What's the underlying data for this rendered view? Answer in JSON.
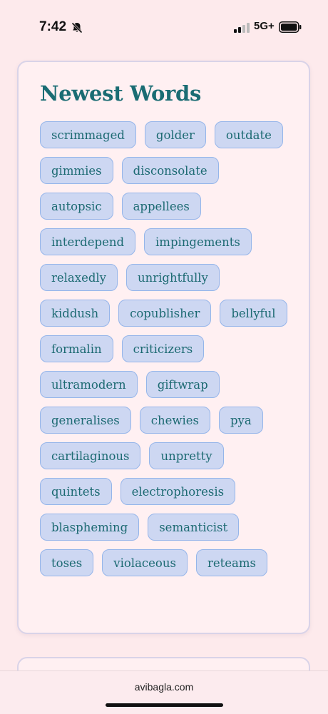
{
  "status_bar": {
    "time": "7:42",
    "network": "5G+",
    "icons": [
      "bell-muted-icon",
      "signal-icon",
      "battery-icon"
    ]
  },
  "newest_words": {
    "title": "Newest Words",
    "words": [
      "scrimmaged",
      "golder",
      "outdate",
      "gimmies",
      "disconsolate",
      "autopsic",
      "appellees",
      "interdepend",
      "impingements",
      "relaxedly",
      "unrightfully",
      "kiddush",
      "copublisher",
      "bellyful",
      "formalin",
      "criticizers",
      "ultramodern",
      "giftwrap",
      "generalises",
      "chewies",
      "pya",
      "cartilaginous",
      "unpretty",
      "quintets",
      "electrophoresis",
      "blaspheming",
      "semanticist",
      "toses",
      "violaceous",
      "reteams"
    ]
  },
  "browser": {
    "url": "avibagla.com"
  },
  "colors": {
    "background": "#fdeaec",
    "card": "#fff0f2",
    "title": "#1a6c73",
    "chip_fill": "#cdd7f2",
    "chip_border": "#95b5ea"
  }
}
